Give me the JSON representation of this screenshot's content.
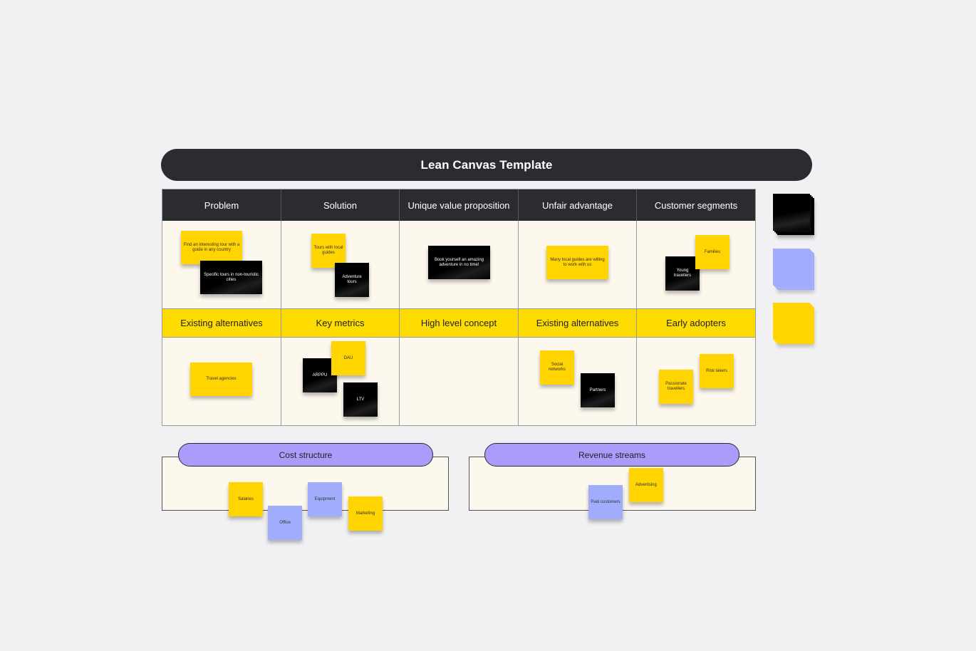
{
  "title": "Lean Canvas Template",
  "top_headers": [
    "Problem",
    "Solution",
    "Unique value proposition",
    "Unfair advantage",
    "Customer segments"
  ],
  "mid_headers": [
    "Existing alternatives",
    "Key metrics",
    "High level concept",
    "Existing alternatives",
    "Early adopters"
  ],
  "colors": {
    "yellow": "#ffd400",
    "black": "#000000",
    "blue": "#a1acfc",
    "pill": "#a99cfb",
    "header_dark": "#2b2c30",
    "header_yellow": "#ffdc00"
  },
  "stickies": {
    "problem": [
      "Find an interesting tour with a guide in any country",
      "Specific tours in non-touristic cities"
    ],
    "solution": [
      "Tours with local guides",
      "Adventure tours"
    ],
    "uvp": [
      "Book yourself an amazing adventure in no time!"
    ],
    "unfair": [
      "Many local guides are willing to work with us"
    ],
    "segments": [
      "Families",
      "Young travellers"
    ],
    "alternatives": [
      "Travel agencies"
    ],
    "metrics": [
      "DAU",
      "ARPPU",
      "LTV"
    ],
    "channels": [
      "Social networks",
      "Partners"
    ],
    "early": [
      "Risk takers",
      "Passionate travellers"
    ],
    "cost": [
      "Salaries",
      "Office",
      "Equipment",
      "Marketing"
    ],
    "revenue": [
      "Advertising",
      "Paid customers"
    ]
  },
  "bottom": {
    "cost_label": "Cost structure",
    "revenue_label": "Revenue streams"
  },
  "palette": [
    "black-sticky-stack",
    "blue-sticky-stack",
    "yellow-sticky-stack"
  ]
}
